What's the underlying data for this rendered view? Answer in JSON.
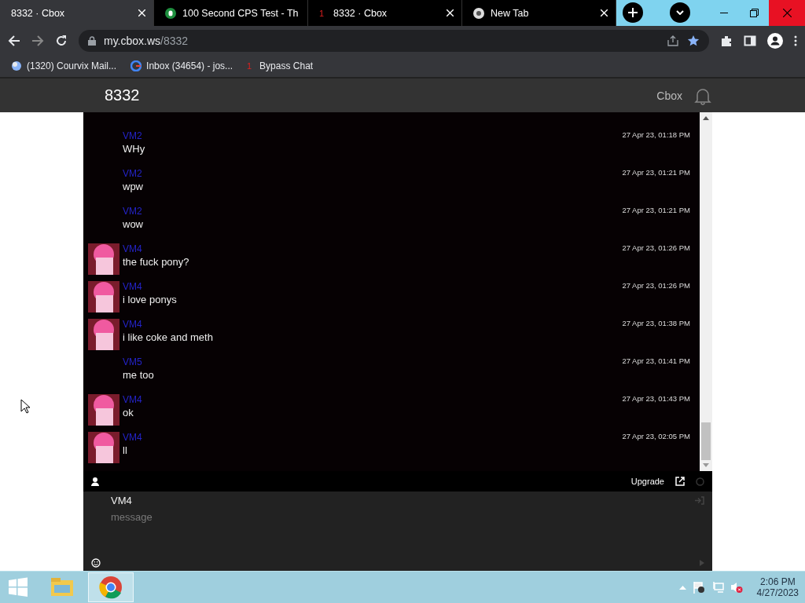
{
  "browser": {
    "tabs": [
      {
        "title": "8332 · Cbox",
        "kind": "plain",
        "selected": true
      },
      {
        "title": "100 Second CPS Test - Th",
        "kind": "shield",
        "selected": false
      },
      {
        "title": "8332 · Cbox",
        "kind": "text",
        "icon_text": "1",
        "selected": false
      },
      {
        "title": "New Tab",
        "kind": "chrome",
        "selected": false
      }
    ],
    "url_host": "my.cbox.ws",
    "url_path": "/8332",
    "bookmarks": [
      {
        "label": "(1320) Courvix Mail...",
        "kind": "globe"
      },
      {
        "label": "Inbox (34654) - jos...",
        "kind": "google"
      },
      {
        "label": "Bypass Chat",
        "kind": "text",
        "icon_text": "1"
      }
    ]
  },
  "header": {
    "title": "8332",
    "brand": "Cbox"
  },
  "messages": [
    {
      "user": "VM2",
      "text": "WHy",
      "time": "27 Apr 23, 01:18 PM",
      "avatar": false
    },
    {
      "user": "VM2",
      "text": "wpw",
      "time": "27 Apr 23, 01:21 PM",
      "avatar": false
    },
    {
      "user": "VM2",
      "text": "wow",
      "time": "27 Apr 23, 01:21 PM",
      "avatar": false
    },
    {
      "user": "VM4",
      "text": "the fuck pony?",
      "time": "27 Apr 23, 01:26 PM",
      "avatar": true
    },
    {
      "user": "VM4",
      "text": "i love ponys",
      "time": "27 Apr 23, 01:26 PM",
      "avatar": true
    },
    {
      "user": "VM4",
      "text": "i like coke and meth",
      "time": "27 Apr 23, 01:38 PM",
      "avatar": true
    },
    {
      "user": "VM5",
      "text": "me too",
      "time": "27 Apr 23, 01:41 PM",
      "avatar": false
    },
    {
      "user": "VM4",
      "text": "ok",
      "time": "27 Apr 23, 01:43 PM",
      "avatar": true
    },
    {
      "user": "VM4",
      "text": "ll",
      "time": "27 Apr 23, 02:05 PM",
      "avatar": true
    }
  ],
  "footer": {
    "upgrade": "Upgrade"
  },
  "compose": {
    "name": "VM4",
    "placeholder": "message"
  },
  "taskbar": {
    "time": "2:06 PM",
    "date": "4/27/2023"
  }
}
